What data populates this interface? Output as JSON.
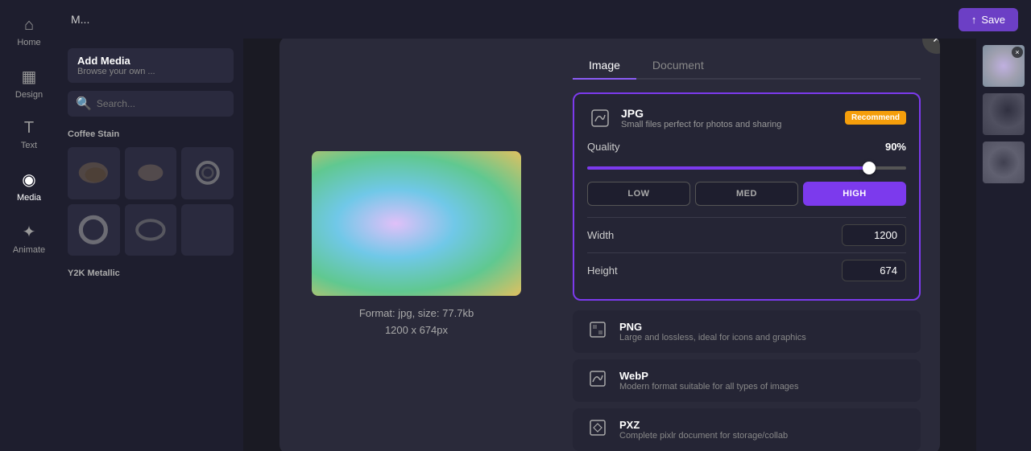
{
  "sidebar": {
    "items": [
      {
        "label": "Home",
        "icon": "⌂"
      },
      {
        "label": "Design",
        "icon": "▦"
      },
      {
        "label": "Text",
        "icon": "T"
      },
      {
        "label": "Media",
        "icon": "◉"
      },
      {
        "label": "Animate",
        "icon": "✦"
      }
    ],
    "active": "Media"
  },
  "topbar": {
    "title": "M...",
    "save_label": "Save",
    "save_icon": "↑"
  },
  "left_panel": {
    "add_media_title": "Add Media",
    "add_media_sub": "Browse your own ...",
    "search_placeholder": "Search...",
    "section_coffee": "Coffee Stain",
    "section_y2k": "Y2K Metallic"
  },
  "modal": {
    "close_label": "×",
    "tabs": [
      {
        "label": "Image",
        "active": true
      },
      {
        "label": "Document",
        "active": false
      }
    ],
    "preview": {
      "format_label": "Format: jpg, size: 77.7kb",
      "dimensions_label": "1200 x 674px"
    },
    "jpg_format": {
      "name": "JPG",
      "description": "Small files perfect for photos and sharing",
      "recommend_badge": "Recommend"
    },
    "quality": {
      "label": "Quality",
      "value": "90%",
      "slider_value": 90,
      "buttons": [
        {
          "label": "LOW",
          "active": false
        },
        {
          "label": "MED",
          "active": false
        },
        {
          "label": "HIGH",
          "active": true
        }
      ]
    },
    "width": {
      "label": "Width",
      "value": "1200"
    },
    "height": {
      "label": "Height",
      "value": "674"
    },
    "other_formats": [
      {
        "name": "PNG",
        "description": "Large and lossless, ideal for icons and graphics"
      },
      {
        "name": "WebP",
        "description": "Modern format suitable for all types of images"
      },
      {
        "name": "PXZ",
        "description": "Complete pixlr document for storage/collab"
      }
    ]
  }
}
